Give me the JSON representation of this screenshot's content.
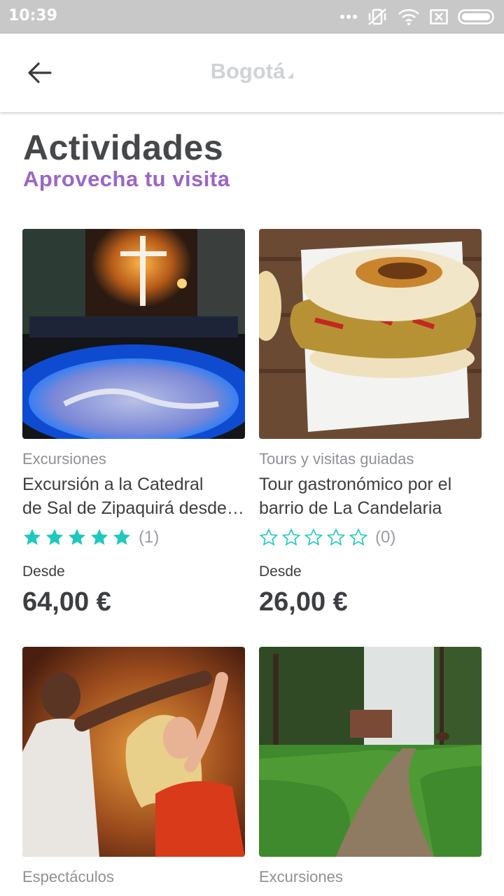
{
  "status_bar": {
    "time": "10:39"
  },
  "app_bar": {
    "title": "Bogotá"
  },
  "header": {
    "title": "Actividades",
    "subtitle": "Aprovecha tu visita"
  },
  "colors": {
    "accent_purple": "#9b65c6",
    "star_teal": "#1ec8bf"
  },
  "activities": [
    {
      "category": "Excursiones",
      "name_line1": "Excursión a la Catedral",
      "name_line2": "de Sal de Zipaquirá desde Bogotá",
      "rating": 5,
      "reviews": "(1)",
      "from_label": "Desde",
      "price": "64,00 €"
    },
    {
      "category": "Tours y visitas guiadas",
      "name_line1": "Tour gastronómico por el",
      "name_line2": "barrio de La Candelaria",
      "rating": 0,
      "reviews": "(0)",
      "from_label": "Desde",
      "price": "26,00 €"
    },
    {
      "category": "Espectáculos"
    },
    {
      "category": "Excursiones"
    }
  ]
}
